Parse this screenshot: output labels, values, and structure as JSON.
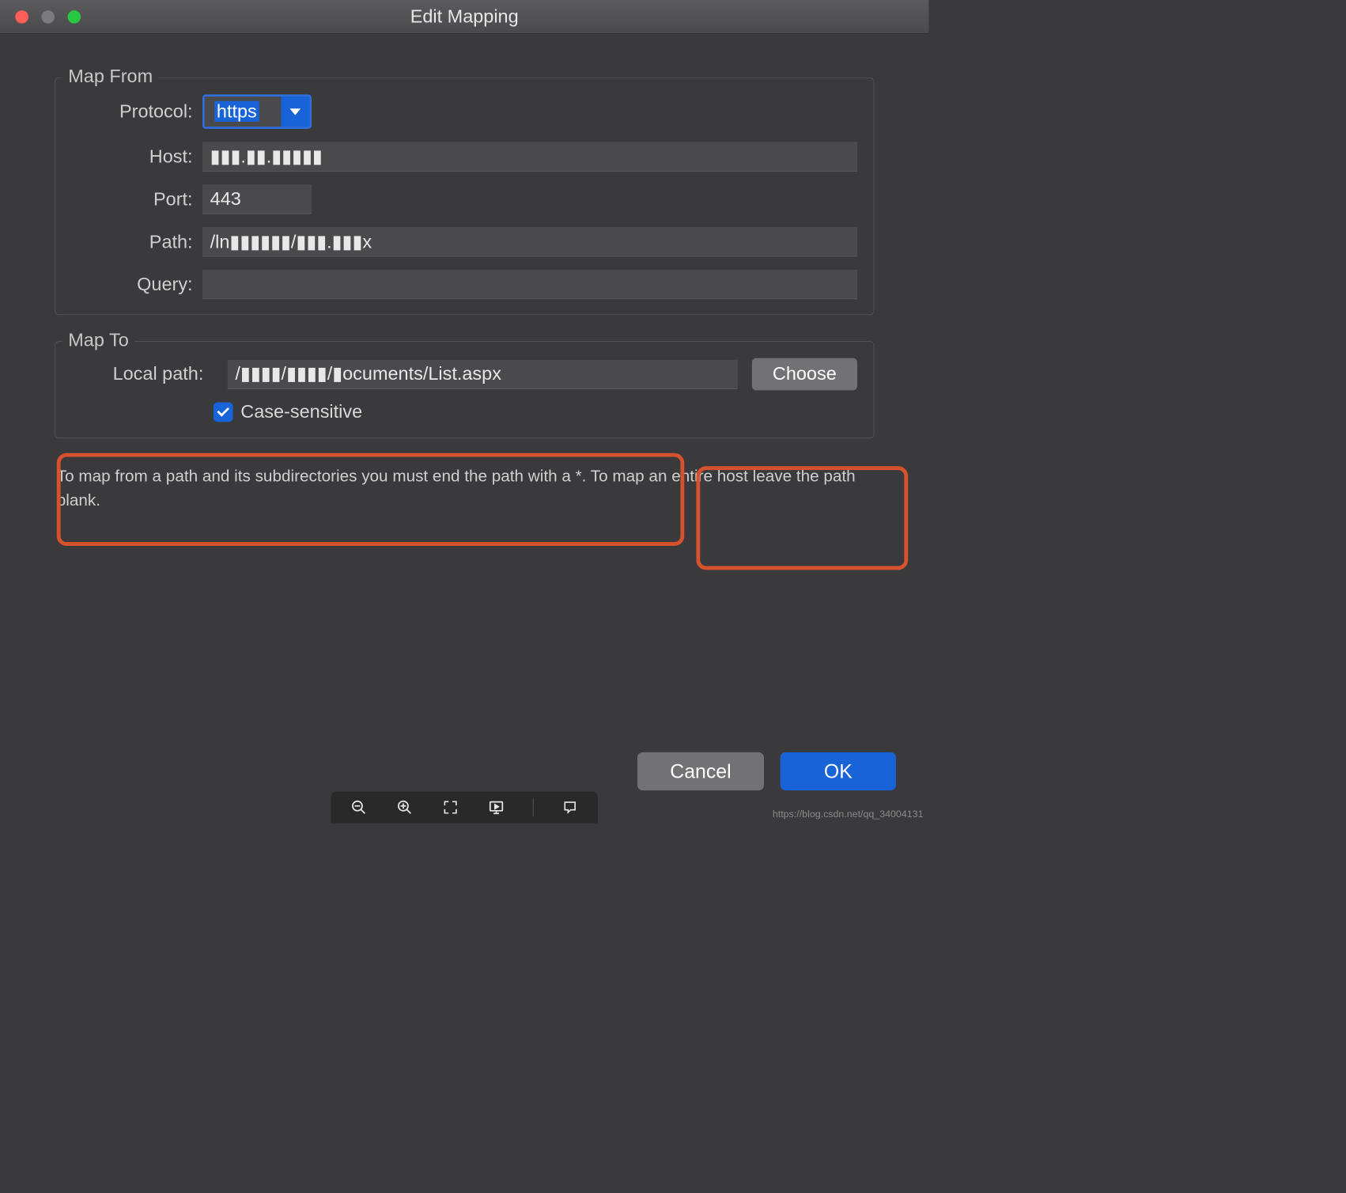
{
  "window": {
    "title": "Edit Mapping"
  },
  "mapFrom": {
    "legend": "Map From",
    "protocol": {
      "label": "Protocol:",
      "value": "https"
    },
    "host": {
      "label": "Host:",
      "value": "▮▮▮.▮▮.▮▮▮▮▮"
    },
    "port": {
      "label": "Port:",
      "value": "443"
    },
    "path": {
      "label": "Path:",
      "value": "/ln▮▮▮▮▮▮/▮▮▮.▮▮▮x"
    },
    "query": {
      "label": "Query:",
      "value": ""
    }
  },
  "mapTo": {
    "legend": "Map To",
    "localPath": {
      "label": "Local path:",
      "value": "/▮▮▮▮/▮▮▮▮/▮ocuments/List.aspx"
    },
    "choose": "Choose",
    "caseSensitive": {
      "label": "Case-sensitive",
      "checked": true
    }
  },
  "hint": "To map from a path and its subdirectories you must end the path with a *. To map an entire host leave the path blank.",
  "footer": {
    "cancel": "Cancel",
    "ok": "OK"
  },
  "watermark": "https://blog.csdn.net/qq_34004131"
}
